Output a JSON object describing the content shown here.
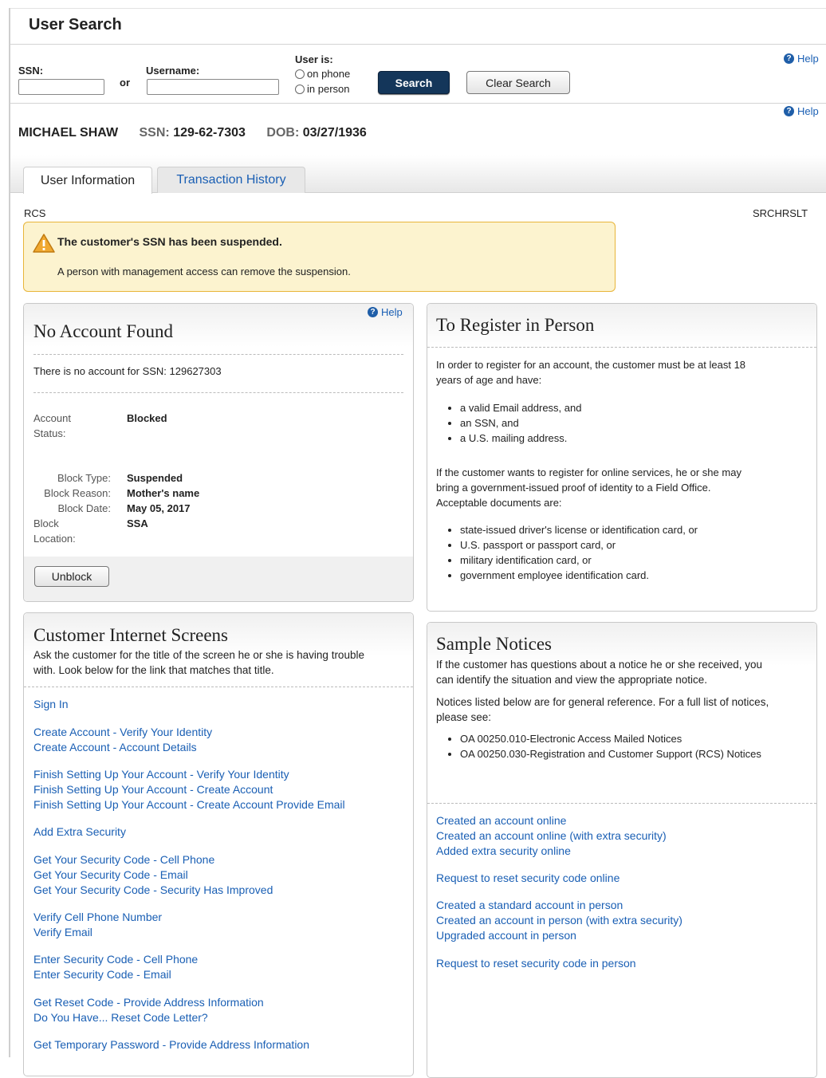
{
  "page": {
    "title": "User Search"
  },
  "search": {
    "ssn_label": "SSN:",
    "or_label": "or",
    "username_label": "Username:",
    "user_is_label": "User is:",
    "radio_phone": "on phone",
    "radio_person": "in person",
    "search_button": "Search",
    "clear_button": "Clear Search",
    "help": "Help"
  },
  "person": {
    "name": "MICHAEL SHAW",
    "ssn_label": "SSN:",
    "ssn": "129-62-7303",
    "dob_label": "DOB:",
    "dob": "03/27/1936",
    "help": "Help"
  },
  "tabs": [
    {
      "label": "User Information",
      "active": true
    },
    {
      "label": "Transaction History",
      "active": false
    }
  ],
  "codes": {
    "left": "RCS",
    "right": "SRCHRSLT"
  },
  "alert": {
    "title": "The customer's SSN has been suspended.",
    "body": "A person with management access can remove the suspension."
  },
  "no_account": {
    "help": "Help",
    "title": "No Account Found",
    "message": "There is no account for SSN: 129627303",
    "status_label_1": "Account",
    "status_label_2": "Status:",
    "status_value": "Blocked",
    "block_type_label": "Block Type:",
    "block_type_value": "Suspended",
    "block_reason_label": "Block Reason:",
    "block_reason_value": "Mother's name",
    "block_date_label": "Block Date:",
    "block_date_value": "May 05, 2017",
    "block_location_label_1": "Block",
    "block_location_label_2": "Location:",
    "block_location_value": "SSA",
    "unblock_button": "Unblock"
  },
  "register": {
    "title": "To Register in Person",
    "intro_1": "In order to register for an account, the customer must be at least 18",
    "intro_2": "years of age and have:",
    "requirements": [
      "a valid Email address, and",
      "an SSN, and",
      "a U.S. mailing address."
    ],
    "para_1": "If the customer wants to register for online services, he or she may",
    "para_2": "bring a government-issued proof of identity to a Field Office.",
    "para_3": "Acceptable documents are:",
    "documents": [
      "state-issued driver's license or identification card, or",
      "U.S. passport or passport card, or",
      "military identification card, or",
      "government employee identification card."
    ]
  },
  "screens": {
    "title": "Customer Internet Screens",
    "desc_1": "Ask the customer for the title of the screen he or she is having trouble",
    "desc_2": "with. Look below for the link that matches that title.",
    "links": [
      "Sign In",
      "Create Account - Verify Your Identity",
      "Create Account - Account Details",
      "Finish Setting Up Your Account - Verify Your Identity",
      "Finish Setting Up Your Account - Create Account",
      "Finish Setting Up Your Account - Create Account Provide Email",
      "Add Extra Security",
      "Get Your Security Code - Cell Phone",
      "Get Your Security Code - Email",
      "Get Your Security Code - Security Has Improved",
      "Verify Cell Phone Number",
      "Verify Email",
      "Enter Security Code - Cell Phone",
      "Enter Security Code - Email",
      "Get Reset Code - Provide Address Information",
      "Do You Have... Reset Code Letter?",
      "Get Temporary Password - Provide Address Information"
    ]
  },
  "notices": {
    "title": "Sample Notices",
    "desc_1": "If the customer has questions about a notice he or she received, you",
    "desc_2": "can identify the situation and view the appropriate notice.",
    "desc_3": "Notices listed below are for general reference. For a full list of notices,",
    "desc_4": "please see:",
    "refs": [
      "OA 00250.010-Electronic Access Mailed Notices",
      "OA 00250.030-Registration and Customer Support (RCS) Notices"
    ],
    "links": [
      "Created an account online",
      "Created an account online (with extra security)",
      "Added extra security online",
      "Request to reset security code online",
      "Created a standard account in person",
      "Created an account in person (with extra security)",
      "Upgraded account in person",
      "Request to reset security code in person"
    ]
  }
}
